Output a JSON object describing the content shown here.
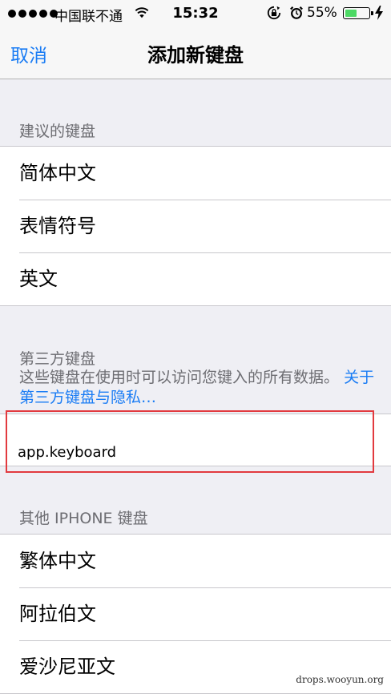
{
  "status_bar": {
    "carrier": "中国联不通",
    "time": "15:32",
    "battery_percent": "55%",
    "battery_level": 0.55,
    "icons": [
      "signal-dots-icon",
      "wifi-icon",
      "rotation-lock-icon",
      "alarm-icon",
      "battery-icon",
      "charging-icon"
    ]
  },
  "nav": {
    "cancel_label": "取消",
    "title": "添加新键盘"
  },
  "suggested": {
    "header": "建议的键盘",
    "items": [
      {
        "label": "简体中文"
      },
      {
        "label": "表情符号"
      },
      {
        "label": "英文"
      }
    ]
  },
  "third_party": {
    "header": "第三方键盘",
    "description": "这些键盘在使用时可以访问您键入的所有数据。",
    "link_text": "关于第三方键盘与隐私…",
    "items": [
      {
        "label": "app.keyboard"
      }
    ]
  },
  "other": {
    "header": "其他 IPHONE 键盘",
    "items": [
      {
        "label": "繁体中文"
      },
      {
        "label": "阿拉伯文"
      },
      {
        "label": "爱沙尼亚文"
      }
    ]
  },
  "watermark": "drops.wooyun.org",
  "colors": {
    "accent": "#1a7cf4",
    "highlight": "#e23a3f",
    "battery_fill": "#4cd964"
  }
}
